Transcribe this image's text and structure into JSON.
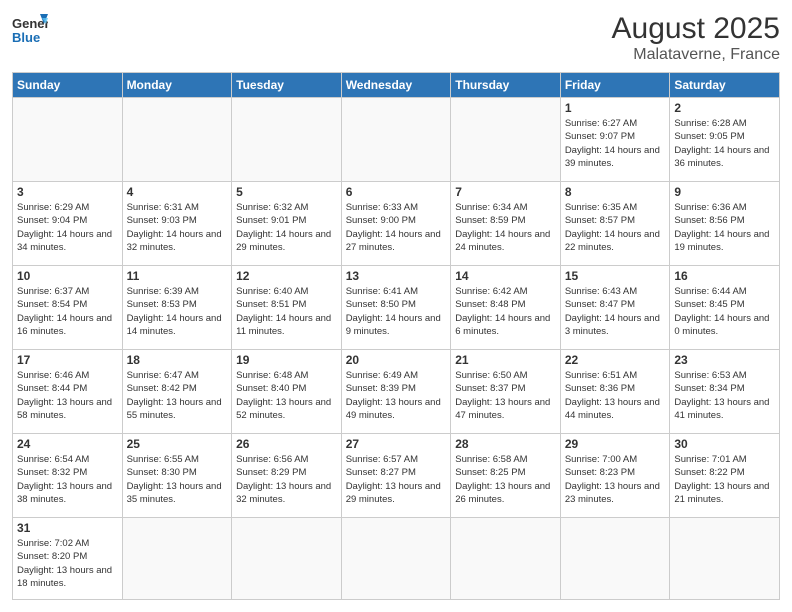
{
  "header": {
    "logo_general": "General",
    "logo_blue": "Blue",
    "month_title": "August 2025",
    "location": "Malataverne, France"
  },
  "days_of_week": [
    "Sunday",
    "Monday",
    "Tuesday",
    "Wednesday",
    "Thursday",
    "Friday",
    "Saturday"
  ],
  "weeks": [
    [
      {
        "day": "",
        "info": ""
      },
      {
        "day": "",
        "info": ""
      },
      {
        "day": "",
        "info": ""
      },
      {
        "day": "",
        "info": ""
      },
      {
        "day": "",
        "info": ""
      },
      {
        "day": "1",
        "info": "Sunrise: 6:27 AM\nSunset: 9:07 PM\nDaylight: 14 hours and 39 minutes."
      },
      {
        "day": "2",
        "info": "Sunrise: 6:28 AM\nSunset: 9:05 PM\nDaylight: 14 hours and 36 minutes."
      }
    ],
    [
      {
        "day": "3",
        "info": "Sunrise: 6:29 AM\nSunset: 9:04 PM\nDaylight: 14 hours and 34 minutes."
      },
      {
        "day": "4",
        "info": "Sunrise: 6:31 AM\nSunset: 9:03 PM\nDaylight: 14 hours and 32 minutes."
      },
      {
        "day": "5",
        "info": "Sunrise: 6:32 AM\nSunset: 9:01 PM\nDaylight: 14 hours and 29 minutes."
      },
      {
        "day": "6",
        "info": "Sunrise: 6:33 AM\nSunset: 9:00 PM\nDaylight: 14 hours and 27 minutes."
      },
      {
        "day": "7",
        "info": "Sunrise: 6:34 AM\nSunset: 8:59 PM\nDaylight: 14 hours and 24 minutes."
      },
      {
        "day": "8",
        "info": "Sunrise: 6:35 AM\nSunset: 8:57 PM\nDaylight: 14 hours and 22 minutes."
      },
      {
        "day": "9",
        "info": "Sunrise: 6:36 AM\nSunset: 8:56 PM\nDaylight: 14 hours and 19 minutes."
      }
    ],
    [
      {
        "day": "10",
        "info": "Sunrise: 6:37 AM\nSunset: 8:54 PM\nDaylight: 14 hours and 16 minutes."
      },
      {
        "day": "11",
        "info": "Sunrise: 6:39 AM\nSunset: 8:53 PM\nDaylight: 14 hours and 14 minutes."
      },
      {
        "day": "12",
        "info": "Sunrise: 6:40 AM\nSunset: 8:51 PM\nDaylight: 14 hours and 11 minutes."
      },
      {
        "day": "13",
        "info": "Sunrise: 6:41 AM\nSunset: 8:50 PM\nDaylight: 14 hours and 9 minutes."
      },
      {
        "day": "14",
        "info": "Sunrise: 6:42 AM\nSunset: 8:48 PM\nDaylight: 14 hours and 6 minutes."
      },
      {
        "day": "15",
        "info": "Sunrise: 6:43 AM\nSunset: 8:47 PM\nDaylight: 14 hours and 3 minutes."
      },
      {
        "day": "16",
        "info": "Sunrise: 6:44 AM\nSunset: 8:45 PM\nDaylight: 14 hours and 0 minutes."
      }
    ],
    [
      {
        "day": "17",
        "info": "Sunrise: 6:46 AM\nSunset: 8:44 PM\nDaylight: 13 hours and 58 minutes."
      },
      {
        "day": "18",
        "info": "Sunrise: 6:47 AM\nSunset: 8:42 PM\nDaylight: 13 hours and 55 minutes."
      },
      {
        "day": "19",
        "info": "Sunrise: 6:48 AM\nSunset: 8:40 PM\nDaylight: 13 hours and 52 minutes."
      },
      {
        "day": "20",
        "info": "Sunrise: 6:49 AM\nSunset: 8:39 PM\nDaylight: 13 hours and 49 minutes."
      },
      {
        "day": "21",
        "info": "Sunrise: 6:50 AM\nSunset: 8:37 PM\nDaylight: 13 hours and 47 minutes."
      },
      {
        "day": "22",
        "info": "Sunrise: 6:51 AM\nSunset: 8:36 PM\nDaylight: 13 hours and 44 minutes."
      },
      {
        "day": "23",
        "info": "Sunrise: 6:53 AM\nSunset: 8:34 PM\nDaylight: 13 hours and 41 minutes."
      }
    ],
    [
      {
        "day": "24",
        "info": "Sunrise: 6:54 AM\nSunset: 8:32 PM\nDaylight: 13 hours and 38 minutes."
      },
      {
        "day": "25",
        "info": "Sunrise: 6:55 AM\nSunset: 8:30 PM\nDaylight: 13 hours and 35 minutes."
      },
      {
        "day": "26",
        "info": "Sunrise: 6:56 AM\nSunset: 8:29 PM\nDaylight: 13 hours and 32 minutes."
      },
      {
        "day": "27",
        "info": "Sunrise: 6:57 AM\nSunset: 8:27 PM\nDaylight: 13 hours and 29 minutes."
      },
      {
        "day": "28",
        "info": "Sunrise: 6:58 AM\nSunset: 8:25 PM\nDaylight: 13 hours and 26 minutes."
      },
      {
        "day": "29",
        "info": "Sunrise: 7:00 AM\nSunset: 8:23 PM\nDaylight: 13 hours and 23 minutes."
      },
      {
        "day": "30",
        "info": "Sunrise: 7:01 AM\nSunset: 8:22 PM\nDaylight: 13 hours and 21 minutes."
      }
    ],
    [
      {
        "day": "31",
        "info": "Sunrise: 7:02 AM\nSunset: 8:20 PM\nDaylight: 13 hours and 18 minutes."
      },
      {
        "day": "",
        "info": ""
      },
      {
        "day": "",
        "info": ""
      },
      {
        "day": "",
        "info": ""
      },
      {
        "day": "",
        "info": ""
      },
      {
        "day": "",
        "info": ""
      },
      {
        "day": "",
        "info": ""
      }
    ]
  ]
}
